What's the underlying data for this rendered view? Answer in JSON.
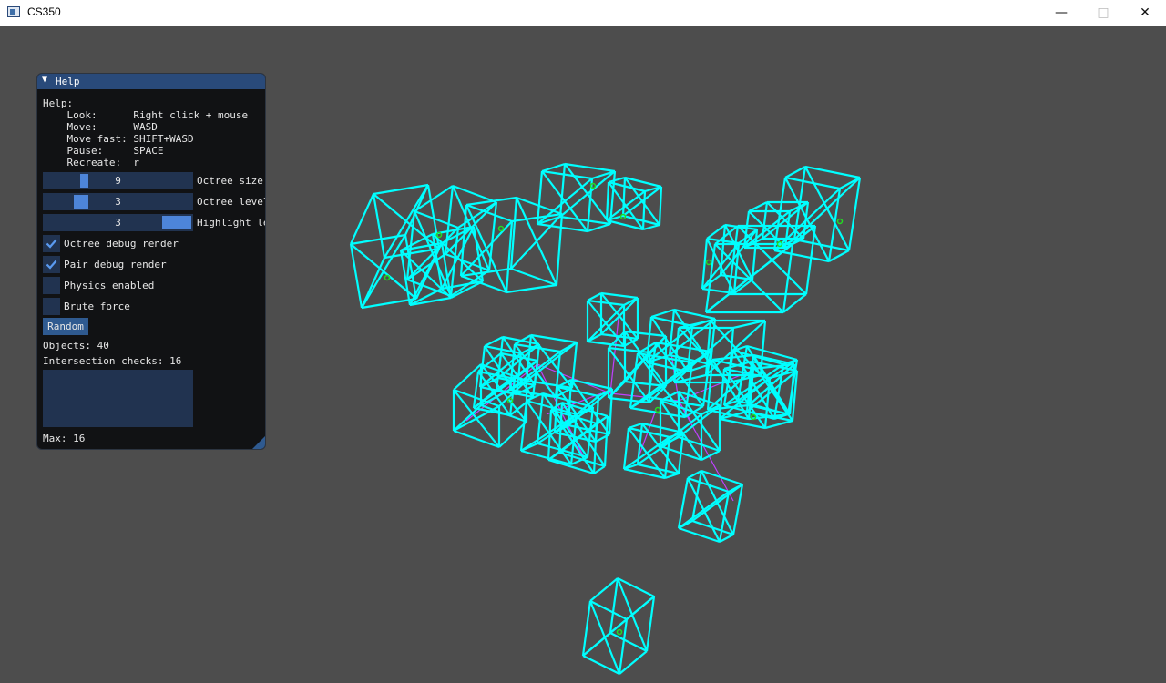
{
  "window": {
    "title": "CS350",
    "minimize_icon": "minimize-icon",
    "maximize_icon": "maximize-icon",
    "close_icon": "close-icon"
  },
  "panel": {
    "title": "Help",
    "help_lines": [
      "Help:",
      "    Look:      Right click + mouse",
      "    Move:      WASD",
      "    Move fast: SHIFT+WASD",
      "    Pause:     SPACE",
      "    Recreate:  r"
    ],
    "sliders": [
      {
        "label": "Octree size",
        "value": "9"
      },
      {
        "label": "Octree level",
        "value": "3"
      },
      {
        "label": "Highlight level",
        "value": "3"
      }
    ],
    "checkboxes": [
      {
        "label": "Octree debug render",
        "checked": true
      },
      {
        "label": "Pair debug render",
        "checked": true
      },
      {
        "label": "Physics enabled",
        "checked": false
      },
      {
        "label": "Brute force",
        "checked": false
      }
    ],
    "random_button": "Random",
    "objects": "Objects: 40",
    "intersection_checks": "Intersection checks: 16",
    "max": "Max: 16"
  },
  "colors": {
    "background": "#4d4d4d",
    "wireframe": "#00ffff",
    "pair_lines": "#cc44ff",
    "centers": "#22dd22",
    "accent": "#4d85d9"
  }
}
